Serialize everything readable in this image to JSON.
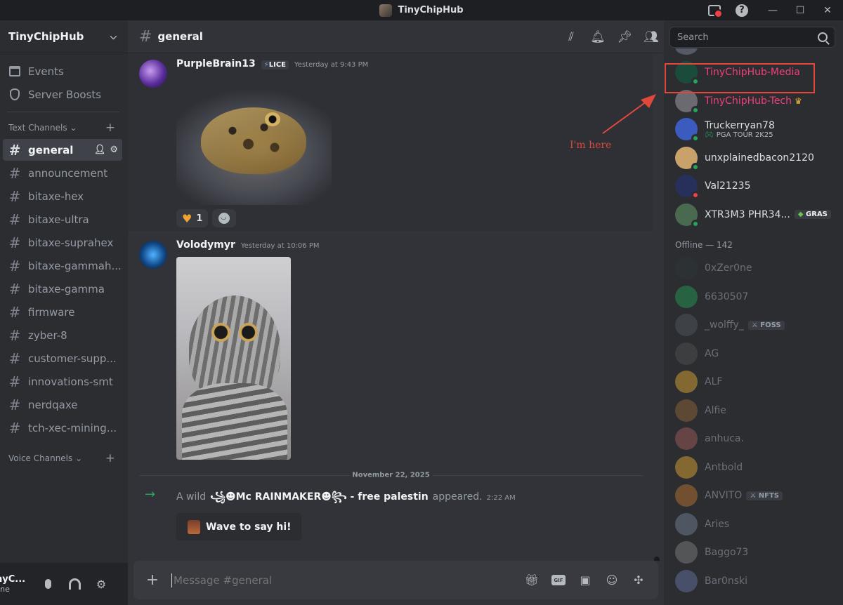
{
  "window": {
    "title": "TinyChipHub",
    "minimize_label": "—",
    "maximize_label": "☐",
    "close_label": "✕"
  },
  "sidebar": {
    "server_name": "TinyChipHub",
    "top_items": [
      {
        "label": "Events",
        "icon": "calendar-icon"
      },
      {
        "label": "Server Boosts",
        "icon": "boost-icon"
      }
    ],
    "text_category": "Text Channels",
    "voice_category": "Voice Channels",
    "channels": [
      "general",
      "announcement",
      "bitaxe-hex",
      "bitaxe-ultra",
      "bitaxe-suprahex",
      "bitaxe-gammah...",
      "bitaxe-gamma",
      "firmware",
      "zyber-8",
      "customer-supp...",
      "innovations-smt",
      "nerdqaxe",
      "tch-xec-mining..."
    ],
    "active_channel": "general",
    "user": {
      "name": "nyC...",
      "status": "line"
    }
  },
  "header": {
    "channel": "general",
    "search_placeholder": "Search"
  },
  "messages": [
    {
      "author": "PurpleBrain13",
      "tag": "LICE",
      "time": "Yesterday at 9:43 PM",
      "reaction_count": "1"
    },
    {
      "author": "Volodymyr",
      "time": "Yesterday at 10:06 PM"
    }
  ],
  "date_divider": "November 22, 2025",
  "join": {
    "prefix": "A wild",
    "who": "꧁☻Mc RAINMAKER☻꧂ - free palestin",
    "suffix": "appeared.",
    "time": "2:22 AM",
    "wave_label": "Wave to say hi!"
  },
  "composer": {
    "placeholder": "Message #general"
  },
  "annotation": {
    "label": "I'm here",
    "color": "#e0483b"
  },
  "members": {
    "online": [
      {
        "name": "TinyChipHub-Media",
        "pink": true,
        "status": "online"
      },
      {
        "name": "TinyChipHub-Tech",
        "pink": true,
        "status": "online",
        "crown": true
      },
      {
        "name": "Truckerryan78",
        "status": "online",
        "activity": "PGA TOUR 2K25"
      },
      {
        "name": "unxplainedbacon2120",
        "status": "online"
      },
      {
        "name": "Val21235",
        "status": "dnd"
      },
      {
        "name": "XTR3M3 PHR34...",
        "status": "online",
        "badge": "GRAS"
      }
    ],
    "offline_label": "Offline — 142",
    "offline": [
      {
        "name": "0xZer0ne"
      },
      {
        "name": "6630507"
      },
      {
        "name": "_wolffy_",
        "badge": "FOSS"
      },
      {
        "name": "AG"
      },
      {
        "name": "ALF"
      },
      {
        "name": "Alfie"
      },
      {
        "name": "anhuca."
      },
      {
        "name": "Antbold"
      },
      {
        "name": "ANVITO",
        "badge": "NFTS"
      },
      {
        "name": "Aries"
      },
      {
        "name": "Baggo73"
      },
      {
        "name": "Bar0nski"
      }
    ]
  }
}
